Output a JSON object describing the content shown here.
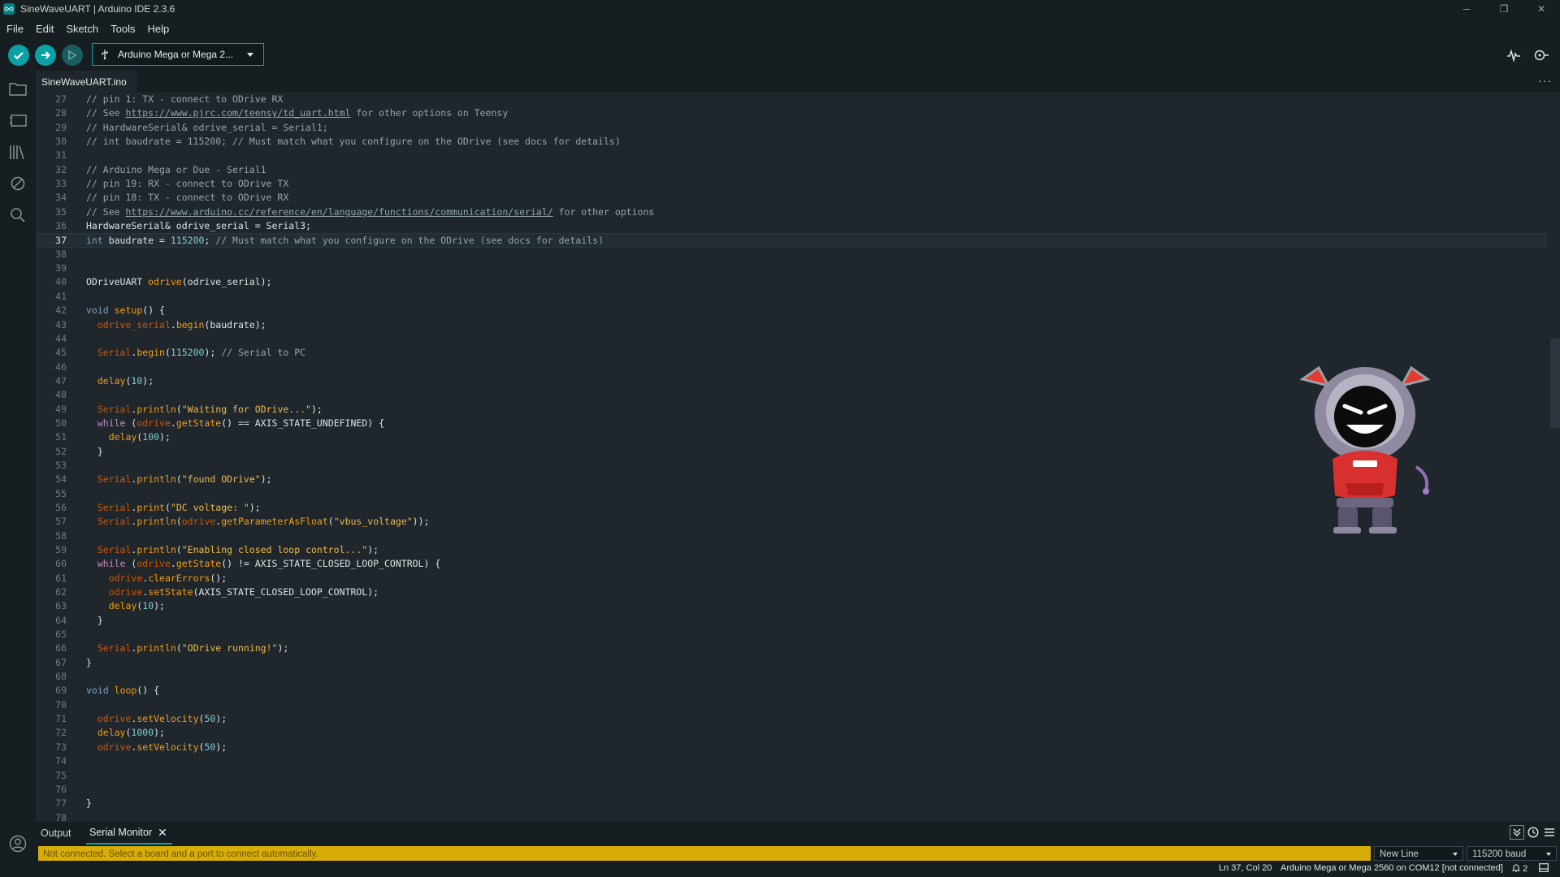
{
  "window": {
    "title": "SineWaveUART | Arduino IDE 2.3.6",
    "controls": {
      "minimize": "─",
      "maximize": "❐",
      "close": "✕"
    }
  },
  "menu": [
    "File",
    "Edit",
    "Sketch",
    "Tools",
    "Help"
  ],
  "toolbar": {
    "board": "Arduino Mega or Mega 2..."
  },
  "sidebar": {
    "items": [
      "sketchbook",
      "boards-manager",
      "library-manager",
      "debug",
      "search"
    ]
  },
  "editor": {
    "tab": "SineWaveUART.ino",
    "more": "···",
    "current_line": 37,
    "lines": [
      {
        "n": 27,
        "tokens": [
          [
            "c",
            "// pin 1: TX - connect to ODrive RX"
          ]
        ]
      },
      {
        "n": 28,
        "tokens": [
          [
            "c",
            "// See "
          ],
          [
            "cu",
            "https://www.pjrc.com/teensy/td_uart.html"
          ],
          [
            "c",
            " for other options on Teensy"
          ]
        ]
      },
      {
        "n": 29,
        "tokens": [
          [
            "c",
            "// HardwareSerial& odrive_serial = Serial1;"
          ]
        ]
      },
      {
        "n": 30,
        "tokens": [
          [
            "c",
            "// int baudrate = 115200; // Must match what you configure on the ODrive (see docs for details)"
          ]
        ]
      },
      {
        "n": 31,
        "tokens": []
      },
      {
        "n": 32,
        "tokens": [
          [
            "c",
            "// Arduino Mega or Due - Serial1"
          ]
        ]
      },
      {
        "n": 33,
        "tokens": [
          [
            "c",
            "// pin 19: RX - connect to ODrive TX"
          ]
        ]
      },
      {
        "n": 34,
        "tokens": [
          [
            "c",
            "// pin 18: TX - connect to ODrive RX"
          ]
        ]
      },
      {
        "n": 35,
        "tokens": [
          [
            "c",
            "// See "
          ],
          [
            "cu",
            "https://www.arduino.cc/reference/en/language/functions/communication/serial/"
          ],
          [
            "c",
            " for other options"
          ]
        ]
      },
      {
        "n": 36,
        "tokens": [
          [
            "p",
            "HardwareSerial& odrive_serial = Serial3;"
          ]
        ]
      },
      {
        "n": 37,
        "tokens": [
          [
            "t",
            "int"
          ],
          [
            "p",
            " baudrate = "
          ],
          [
            "n",
            "115200"
          ],
          [
            "p",
            "; "
          ],
          [
            "c",
            "// Must match what you configure on the ODrive (see docs for details)"
          ]
        ]
      },
      {
        "n": 38,
        "tokens": []
      },
      {
        "n": 39,
        "tokens": []
      },
      {
        "n": 40,
        "tokens": [
          [
            "p",
            "ODriveUART "
          ],
          [
            "f",
            "odrive"
          ],
          [
            "p",
            "(odrive_serial);"
          ]
        ]
      },
      {
        "n": 41,
        "tokens": []
      },
      {
        "n": 42,
        "tokens": [
          [
            "t",
            "void"
          ],
          [
            "p",
            " "
          ],
          [
            "f",
            "setup"
          ],
          [
            "p",
            "() {"
          ]
        ]
      },
      {
        "n": 43,
        "tokens": [
          [
            "p",
            "  "
          ],
          [
            "v",
            "odrive_serial"
          ],
          [
            "p",
            "."
          ],
          [
            "f",
            "begin"
          ],
          [
            "p",
            "(baudrate);"
          ]
        ]
      },
      {
        "n": 44,
        "tokens": []
      },
      {
        "n": 45,
        "tokens": [
          [
            "p",
            "  "
          ],
          [
            "v",
            "Serial"
          ],
          [
            "p",
            "."
          ],
          [
            "f",
            "begin"
          ],
          [
            "p",
            "("
          ],
          [
            "n",
            "115200"
          ],
          [
            "p",
            "); "
          ],
          [
            "c",
            "// Serial to PC"
          ]
        ]
      },
      {
        "n": 46,
        "tokens": []
      },
      {
        "n": 47,
        "tokens": [
          [
            "p",
            "  "
          ],
          [
            "f",
            "delay"
          ],
          [
            "p",
            "("
          ],
          [
            "n",
            "10"
          ],
          [
            "p",
            ");"
          ]
        ]
      },
      {
        "n": 48,
        "tokens": []
      },
      {
        "n": 49,
        "tokens": [
          [
            "p",
            "  "
          ],
          [
            "v",
            "Serial"
          ],
          [
            "p",
            "."
          ],
          [
            "f",
            "println"
          ],
          [
            "p",
            "("
          ],
          [
            "s",
            "\"Waiting for ODrive...\""
          ],
          [
            "p",
            ");"
          ]
        ]
      },
      {
        "n": 50,
        "tokens": [
          [
            "p",
            "  "
          ],
          [
            "k",
            "while"
          ],
          [
            "p",
            " ("
          ],
          [
            "v",
            "odrive"
          ],
          [
            "p",
            "."
          ],
          [
            "f",
            "getState"
          ],
          [
            "p",
            "() == AXIS_STATE_UNDEFINED) {"
          ]
        ]
      },
      {
        "n": 51,
        "tokens": [
          [
            "p",
            "    "
          ],
          [
            "f",
            "delay"
          ],
          [
            "p",
            "("
          ],
          [
            "n",
            "100"
          ],
          [
            "p",
            ");"
          ]
        ]
      },
      {
        "n": 52,
        "tokens": [
          [
            "p",
            "  }"
          ]
        ]
      },
      {
        "n": 53,
        "tokens": []
      },
      {
        "n": 54,
        "tokens": [
          [
            "p",
            "  "
          ],
          [
            "v",
            "Serial"
          ],
          [
            "p",
            "."
          ],
          [
            "f",
            "println"
          ],
          [
            "p",
            "("
          ],
          [
            "s",
            "\"found ODrive\""
          ],
          [
            "p",
            ");"
          ]
        ]
      },
      {
        "n": 55,
        "tokens": []
      },
      {
        "n": 56,
        "tokens": [
          [
            "p",
            "  "
          ],
          [
            "v",
            "Serial"
          ],
          [
            "p",
            "."
          ],
          [
            "f",
            "print"
          ],
          [
            "p",
            "("
          ],
          [
            "s",
            "\"DC voltage: \""
          ],
          [
            "p",
            ");"
          ]
        ]
      },
      {
        "n": 57,
        "tokens": [
          [
            "p",
            "  "
          ],
          [
            "v",
            "Serial"
          ],
          [
            "p",
            "."
          ],
          [
            "f",
            "println"
          ],
          [
            "p",
            "("
          ],
          [
            "v",
            "odrive"
          ],
          [
            "p",
            "."
          ],
          [
            "f",
            "getParameterAsFloat"
          ],
          [
            "p",
            "("
          ],
          [
            "s",
            "\"vbus_voltage\""
          ],
          [
            "p",
            "));"
          ]
        ]
      },
      {
        "n": 58,
        "tokens": []
      },
      {
        "n": 59,
        "tokens": [
          [
            "p",
            "  "
          ],
          [
            "v",
            "Serial"
          ],
          [
            "p",
            "."
          ],
          [
            "f",
            "println"
          ],
          [
            "p",
            "("
          ],
          [
            "s",
            "\"Enabling closed loop control...\""
          ],
          [
            "p",
            ");"
          ]
        ]
      },
      {
        "n": 60,
        "tokens": [
          [
            "p",
            "  "
          ],
          [
            "k",
            "while"
          ],
          [
            "p",
            " ("
          ],
          [
            "v",
            "odrive"
          ],
          [
            "p",
            "."
          ],
          [
            "f",
            "getState"
          ],
          [
            "p",
            "() != AXIS_STATE_CLOSED_LOOP_CONTROL) {"
          ]
        ]
      },
      {
        "n": 61,
        "tokens": [
          [
            "p",
            "    "
          ],
          [
            "v",
            "odrive"
          ],
          [
            "p",
            "."
          ],
          [
            "f",
            "clearErrors"
          ],
          [
            "p",
            "();"
          ]
        ]
      },
      {
        "n": 62,
        "tokens": [
          [
            "p",
            "    "
          ],
          [
            "v",
            "odrive"
          ],
          [
            "p",
            "."
          ],
          [
            "f",
            "setState"
          ],
          [
            "p",
            "(AXIS_STATE_CLOSED_LOOP_CONTROL);"
          ]
        ]
      },
      {
        "n": 63,
        "tokens": [
          [
            "p",
            "    "
          ],
          [
            "f",
            "delay"
          ],
          [
            "p",
            "("
          ],
          [
            "n",
            "10"
          ],
          [
            "p",
            ");"
          ]
        ]
      },
      {
        "n": 64,
        "tokens": [
          [
            "p",
            "  }"
          ]
        ]
      },
      {
        "n": 65,
        "tokens": []
      },
      {
        "n": 66,
        "tokens": [
          [
            "p",
            "  "
          ],
          [
            "v",
            "Serial"
          ],
          [
            "p",
            "."
          ],
          [
            "f",
            "println"
          ],
          [
            "p",
            "("
          ],
          [
            "s",
            "\"ODrive running!\""
          ],
          [
            "p",
            ");"
          ]
        ]
      },
      {
        "n": 67,
        "tokens": [
          [
            "p",
            "}"
          ]
        ]
      },
      {
        "n": 68,
        "tokens": []
      },
      {
        "n": 69,
        "tokens": [
          [
            "t",
            "void"
          ],
          [
            "p",
            " "
          ],
          [
            "f",
            "loop"
          ],
          [
            "p",
            "() {"
          ]
        ]
      },
      {
        "n": 70,
        "tokens": []
      },
      {
        "n": 71,
        "tokens": [
          [
            "p",
            "  "
          ],
          [
            "v",
            "odrive"
          ],
          [
            "p",
            "."
          ],
          [
            "f",
            "setVelocity"
          ],
          [
            "p",
            "("
          ],
          [
            "n",
            "50"
          ],
          [
            "p",
            ");"
          ]
        ]
      },
      {
        "n": 72,
        "tokens": [
          [
            "p",
            "  "
          ],
          [
            "f",
            "delay"
          ],
          [
            "p",
            "("
          ],
          [
            "n",
            "1000"
          ],
          [
            "p",
            ");"
          ]
        ]
      },
      {
        "n": 73,
        "tokens": [
          [
            "p",
            "  "
          ],
          [
            "v",
            "odrive"
          ],
          [
            "p",
            "."
          ],
          [
            "f",
            "setVelocity"
          ],
          [
            "p",
            "("
          ],
          [
            "n",
            "50"
          ],
          [
            "p",
            ");"
          ]
        ]
      },
      {
        "n": 74,
        "tokens": []
      },
      {
        "n": 75,
        "tokens": []
      },
      {
        "n": 76,
        "tokens": []
      },
      {
        "n": 77,
        "tokens": [
          [
            "p",
            "}"
          ]
        ]
      },
      {
        "n": 78,
        "tokens": []
      }
    ]
  },
  "panel": {
    "tabs": [
      "Output",
      "Serial Monitor"
    ],
    "close": "✕",
    "notice": "Not connected. Select a board and a port to connect automatically.",
    "line_ending": "New Line",
    "baud": "115200 baud"
  },
  "status": {
    "position": "Ln 37, Col 20",
    "board": "Arduino Mega or Mega 2560 on COM12 [not connected]",
    "notifications": "2"
  },
  "colors": {
    "accent": "#0ca1a6",
    "background": "#1f272d",
    "chrome": "#171e21",
    "warning": "#d9ad08"
  }
}
